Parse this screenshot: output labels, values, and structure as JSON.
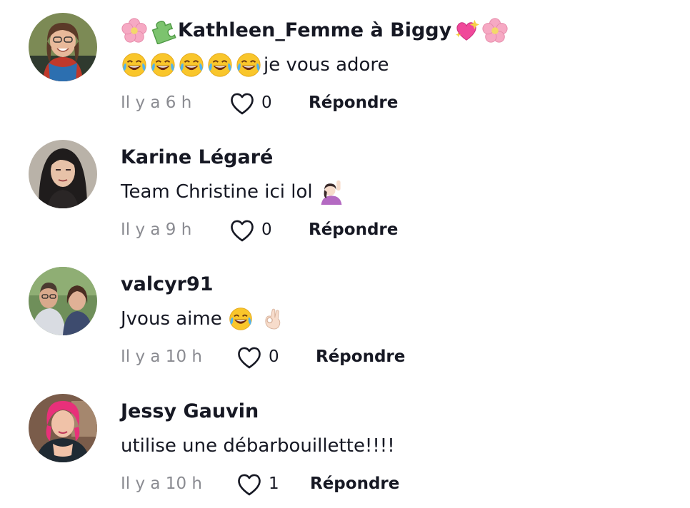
{
  "comments": [
    {
      "username": "Kathleen_Femme à Biggy",
      "text": "je vous adore",
      "time": "Il y a 6 h",
      "likes": "0",
      "reply_label": "Répondre"
    },
    {
      "username": "Karine Légaré",
      "text": "Team Christine ici lol",
      "time": "Il y a 9 h",
      "likes": "0",
      "reply_label": "Répondre"
    },
    {
      "username": "valcyr91",
      "text": "Jvous aime",
      "time": "Il y a 10 h",
      "likes": "0",
      "reply_label": "Répondre"
    },
    {
      "username": "Jessy Gauvin",
      "text": "utilise une débarbouillette!!!!",
      "time": "Il y a 10 h",
      "likes": "1",
      "reply_label": "Répondre"
    }
  ],
  "icons": {
    "like": "heart-outline-icon",
    "emoji_laugh": "face-with-tears-of-joy-emoji",
    "emoji_flower": "cherry-blossom-emoji",
    "emoji_puzzle": "puzzle-piece-emoji",
    "emoji_heart": "sparkling-heart-emoji",
    "emoji_raise_hand": "person-raising-hand-emoji",
    "emoji_ok": "ok-hand-emoji"
  },
  "colors": {
    "text": "#161823",
    "meta": "#8a8b91",
    "heart_stroke": "#161823"
  }
}
